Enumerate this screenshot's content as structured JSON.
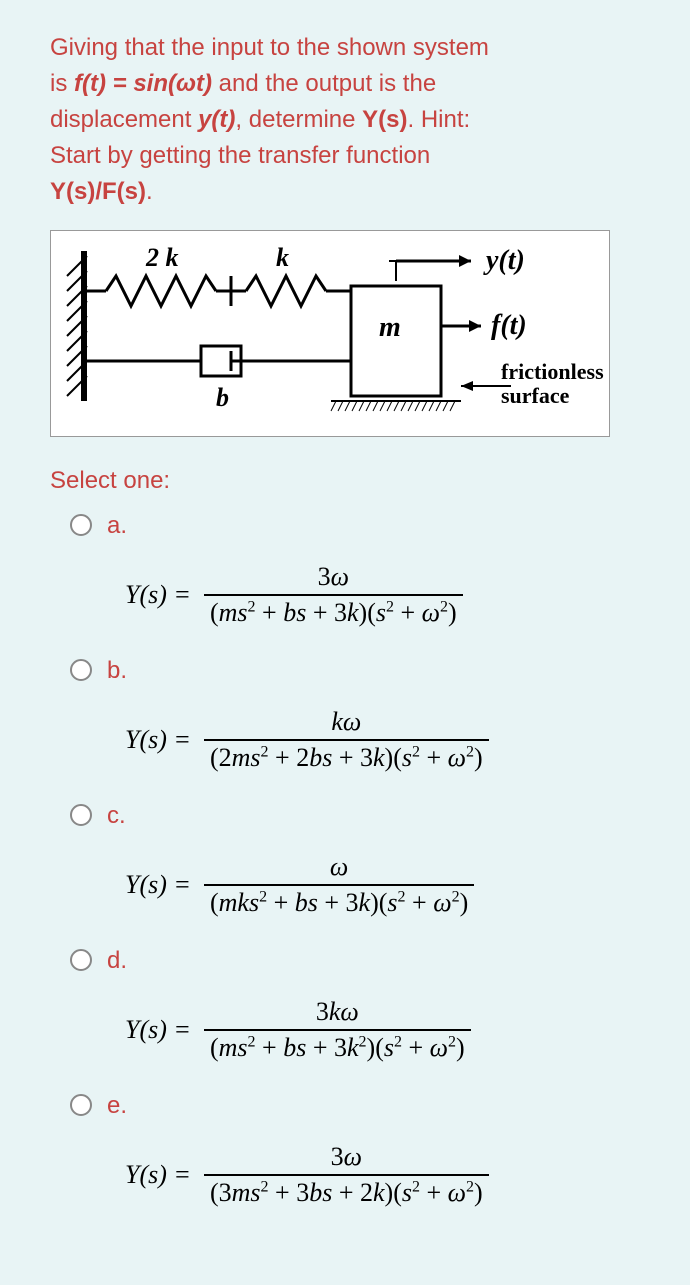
{
  "question": {
    "line1": "Giving that the input to the shown system",
    "line2_pre": "is ",
    "line2_bold": "f(t) = sin(ωt)",
    "line2_post": " and the output is the",
    "line3_pre": "displacement ",
    "line3_bold": "y(t)",
    "line3_mid": ", determine ",
    "line3_bold2": "Y(s)",
    "line3_post": ". Hint:",
    "line4": "Start by getting the transfer function",
    "line5": "Y(s)/F(s)",
    "line5_post": "."
  },
  "diagram": {
    "label_2k": "2 k",
    "label_k": "k",
    "label_b": "b",
    "label_m": "m",
    "label_yt": "y(t)",
    "label_ft": "f(t)",
    "label_frictionless": "frictionless",
    "label_surface": "surface"
  },
  "select": "Select one:",
  "options": {
    "a": {
      "label": "a.",
      "num": "3ω",
      "den_pre": "(ms",
      "den_mid1": " + bs + 3k)(s",
      "den_post": " + ω",
      "den_end": ")"
    },
    "b": {
      "label": "b.",
      "num": "kω",
      "den_pre": "(2ms",
      "den_mid1": " + 2bs + 3k)(s",
      "den_post": " + ω",
      "den_end": ")"
    },
    "c": {
      "label": "c.",
      "num": "ω",
      "den_pre": "(mks",
      "den_mid1": " + bs + 3k)(s",
      "den_post": " + ω",
      "den_end": ")"
    },
    "d": {
      "label": "d.",
      "num": "3kω",
      "den_pre": "(ms",
      "den_mid1": " + bs + 3k",
      "den_mid2": ")(s",
      "den_post": " + ω",
      "den_end": ")"
    },
    "e": {
      "label": "e.",
      "num": "3ω",
      "den_pre": "(3ms",
      "den_mid1": " + 3bs + 2k)(s",
      "den_post": " + ω",
      "den_end": ")"
    }
  },
  "ys_label": "Y(s) ="
}
